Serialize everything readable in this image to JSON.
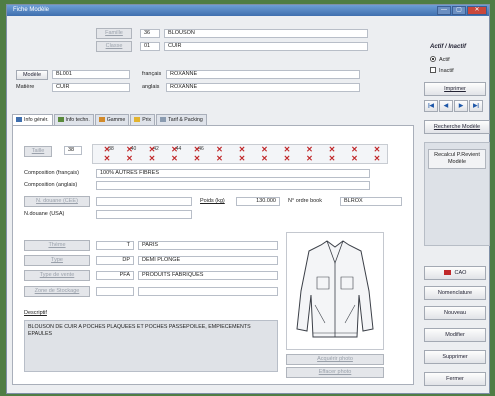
{
  "window": {
    "title": "Fiche Modèle",
    "controls": [
      "—",
      "▢",
      "✕"
    ]
  },
  "header": {
    "famille": {
      "label": "Famille",
      "code": "36",
      "value": "BLOUSON"
    },
    "classe": {
      "label": "Classe",
      "code": "01",
      "value": "CUIR"
    },
    "modele": {
      "label": "Modèle",
      "value": "BL001",
      "francais_label": "français",
      "francais_value": "ROXANNE"
    },
    "matiere": {
      "label": "Matière",
      "value": "CUIR",
      "anglais_label": "anglais",
      "anglais_value": "ROXANNE"
    }
  },
  "status": {
    "title": "Actif / Inactif",
    "actif": "Actif",
    "inactif": "Inactif"
  },
  "right_buttons": {
    "imprimer": "Imprimer",
    "recherche": "Recherche Modèle",
    "recalcul": "Recalcul P.Revient Modèle",
    "cao": "CAO",
    "nomenclature": "Nomenclature",
    "nouveau": "Nouveau",
    "modifier": "Modifier",
    "supprimer": "Supprimer",
    "fermer": "Fermer"
  },
  "nav": [
    "|◀",
    "◀",
    "▶",
    "▶|"
  ],
  "tabs": [
    "Info génér.",
    "Info techn.",
    "Gamme",
    "Prix",
    "Tarif & Packing"
  ],
  "general": {
    "taille_label": "Taille",
    "taille_value": "38",
    "sizes": [
      "38",
      "40",
      "42",
      "44",
      "46",
      "",
      "",
      "",
      "",
      "",
      "",
      "",
      ""
    ],
    "composition_fr_label": "Composition (français)",
    "composition_fr_value": "100% AUTRES FIBRES",
    "composition_en_label": "Composition (anglais)",
    "composition_en_value": "",
    "douane_label": "N. douane (CEE)",
    "douane_value": "",
    "douane_usa_label": "N.douane (USA)",
    "poids_label": "Poids (kg)",
    "poids_value": "130.000",
    "ordre_label": "N° ordre book",
    "ordre_value": "BLROX",
    "theme": {
      "label": "Thème",
      "code": "T",
      "value": "PARIS"
    },
    "type": {
      "label": "Type",
      "code": "DP",
      "value": "DEMI PLONGE"
    },
    "type_vente": {
      "label": "Type de vente",
      "code": "PFA",
      "value": "PRODUITS FABRIQUES"
    },
    "zone_stockage": {
      "label": "Zone de Stockage",
      "code": "",
      "value": ""
    },
    "descriptif_label": "Descriptif",
    "descriptif_value": "BLOUSON DE CUIR A POCHES PLAQUEES ET POCHES PASSEPOILEE, EMPIECEMENTS EPAULES",
    "photo_button": "Acquérir photo",
    "effacer_button": "Effacer photo"
  },
  "colors": {
    "accent": "#3f6fae",
    "cross": "#c0282a",
    "background": "#4f7d44"
  }
}
